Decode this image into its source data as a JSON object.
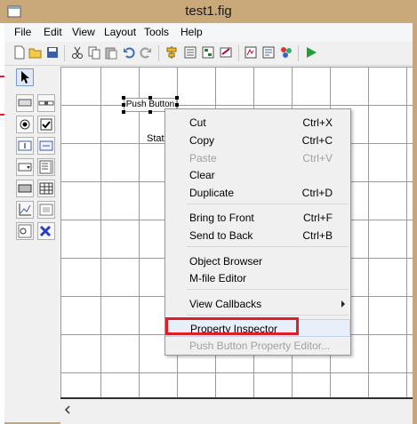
{
  "window": {
    "title": "test1.fig"
  },
  "menubar": [
    "File",
    "Edit",
    "View",
    "Layout",
    "Tools",
    "Help"
  ],
  "toolbar_icons": [
    "new-icon",
    "open-icon",
    "save-icon",
    "cut-icon",
    "copy-icon",
    "paste-icon",
    "undo-icon",
    "redo-icon",
    "align-icon",
    "menu-editor-icon",
    "tab-order-icon",
    "toolbar-editor-icon",
    "mfile-editor-icon",
    "property-inspector-icon",
    "object-browser-icon",
    "run-icon"
  ],
  "palette": [
    "select-tool",
    "push-button-tool",
    "slider-tool",
    "radio-button-tool",
    "checkbox-tool",
    "edit-text-tool",
    "static-text-tool",
    "popup-menu-tool",
    "listbox-tool",
    "toggle-button-tool",
    "table-tool",
    "axes-tool",
    "panel-tool",
    "button-group-tool",
    "activex-tool"
  ],
  "canvas": {
    "push_button_label": "Push Button",
    "static_text_label": "Stati"
  },
  "context_menu": {
    "items": [
      {
        "label": "Cut",
        "shortcut": "Ctrl+X",
        "enabled": true
      },
      {
        "label": "Copy",
        "shortcut": "Ctrl+C",
        "enabled": true
      },
      {
        "label": "Paste",
        "shortcut": "Ctrl+V",
        "enabled": false
      },
      {
        "label": "Clear",
        "shortcut": "",
        "enabled": true
      },
      {
        "label": "Duplicate",
        "shortcut": "Ctrl+D",
        "enabled": true
      },
      {
        "label": "Bring to Front",
        "shortcut": "Ctrl+F",
        "enabled": true
      },
      {
        "label": "Send to Back",
        "shortcut": "Ctrl+B",
        "enabled": true
      },
      {
        "label": "Object Browser",
        "shortcut": "",
        "enabled": true
      },
      {
        "label": "M-file Editor",
        "shortcut": "",
        "enabled": true
      },
      {
        "label": "View Callbacks",
        "shortcut": "",
        "enabled": true
      },
      {
        "label": "Property Inspector",
        "shortcut": "",
        "enabled": true
      },
      {
        "label": "Push Button Property Editor...",
        "shortcut": "",
        "enabled": false
      }
    ],
    "highlighted": "Property Inspector"
  },
  "colors": {
    "frame": "#c8a57a",
    "highlight_box": "#e11d2a",
    "run": "#1f9e3a"
  }
}
